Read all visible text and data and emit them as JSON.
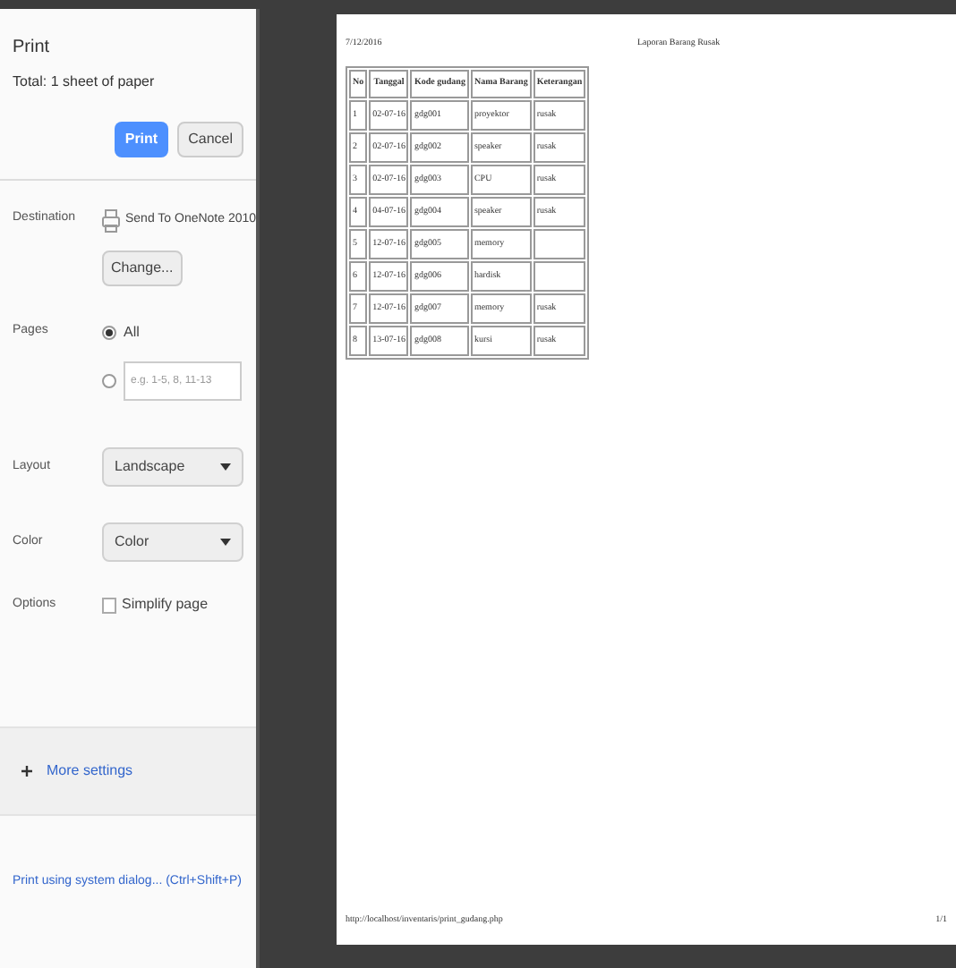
{
  "panel": {
    "title": "Print",
    "total": "Total: 1 sheet of paper",
    "print_button": "Print",
    "cancel_button": "Cancel",
    "destination": {
      "label": "Destination",
      "printer": "Send To OneNote 2010",
      "change_button": "Change..."
    },
    "pages": {
      "label": "Pages",
      "options": [
        {
          "kind": "label",
          "text": "All",
          "selected": true
        },
        {
          "kind": "field",
          "placeholder": "e.g. 1-5, 8, 11-13",
          "selected": false
        }
      ]
    },
    "layout": {
      "label": "Layout",
      "value": "Landscape"
    },
    "color": {
      "label": "Color",
      "value": "Color"
    },
    "options": {
      "label": "Options",
      "simplify": {
        "text": "Simplify page",
        "checked": false
      }
    },
    "more_settings": "More settings",
    "system_dialog": "Print using system dialog... (Ctrl+Shift+P)"
  },
  "preview": {
    "header_date": "7/12/2016",
    "header_title": "Laporan Barang Rusak",
    "table": {
      "columns": [
        "No",
        "Tanggal",
        "Kode gudang",
        "Nama Barang",
        "Keterangan"
      ],
      "rows": [
        [
          "1",
          "02-07-16",
          "gdg001",
          "proyektor",
          "rusak"
        ],
        [
          "2",
          "02-07-16",
          "gdg002",
          "speaker",
          "rusak"
        ],
        [
          "3",
          "02-07-16",
          "gdg003",
          "CPU",
          "rusak"
        ],
        [
          "4",
          "04-07-16",
          "gdg004",
          "speaker",
          "rusak"
        ],
        [
          "5",
          "12-07-16",
          "gdg005",
          "memory",
          ""
        ],
        [
          "6",
          "12-07-16",
          "gdg006",
          "hardisk",
          ""
        ],
        [
          "7",
          "12-07-16",
          "gdg007",
          "memory",
          "rusak"
        ],
        [
          "8",
          "13-07-16",
          "gdg008",
          "kursi",
          "rusak"
        ]
      ]
    },
    "footer_url": "http://localhost/inventaris/print_gudang.php",
    "footer_page": "1/1"
  }
}
